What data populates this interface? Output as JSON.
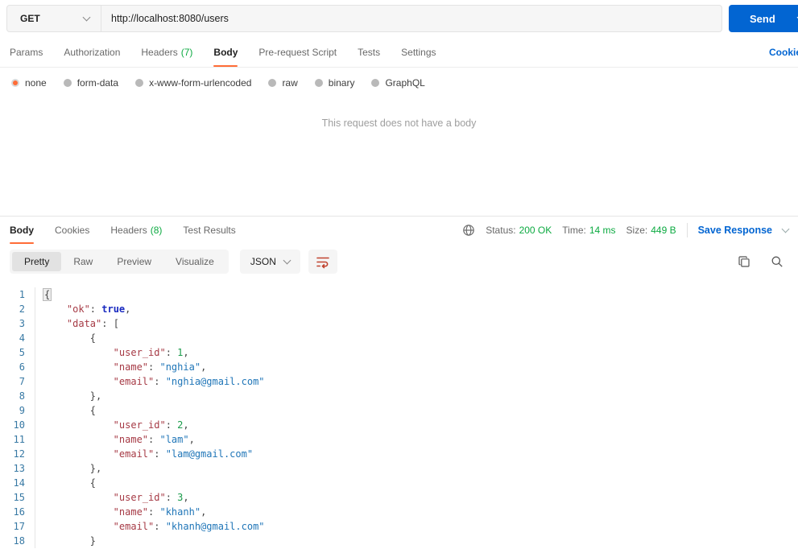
{
  "colors": {
    "accent": "#FF6C37",
    "blue": "#0265D2",
    "green": "#0CAA41"
  },
  "icons": [
    "chevron-down-icon",
    "globe-icon",
    "wrap-text-icon",
    "copy-icon",
    "search-icon"
  ],
  "request": {
    "method": "GET",
    "url": "http://localhost:8080/users",
    "send_label": "Send",
    "cookies_link": "Cookies",
    "tabs": [
      {
        "label": "Params"
      },
      {
        "label": "Authorization"
      },
      {
        "label": "Headers",
        "count": "(7)"
      },
      {
        "label": "Body",
        "active": true
      },
      {
        "label": "Pre-request Script"
      },
      {
        "label": "Tests"
      },
      {
        "label": "Settings"
      }
    ],
    "body_types": [
      "none",
      "form-data",
      "x-www-form-urlencoded",
      "raw",
      "binary",
      "GraphQL"
    ],
    "body_type_selected": "none",
    "empty_body_message": "This request does not have a body"
  },
  "response": {
    "tabs": [
      {
        "label": "Body",
        "active": true
      },
      {
        "label": "Cookies"
      },
      {
        "label": "Headers",
        "count": "(8)"
      },
      {
        "label": "Test Results"
      }
    ],
    "status_label": "Status:",
    "status_value": "200 OK",
    "time_label": "Time:",
    "time_value": "14 ms",
    "size_label": "Size:",
    "size_value": "449 B",
    "save_response_label": "Save Response",
    "view_modes": [
      "Pretty",
      "Raw",
      "Preview",
      "Visualize"
    ],
    "view_mode_active": "Pretty",
    "format": "JSON"
  },
  "code": {
    "lines": [
      {
        "n": 1,
        "indent": 0,
        "tokens": [
          [
            "brace",
            "{"
          ]
        ]
      },
      {
        "n": 2,
        "indent": 1,
        "tokens": [
          [
            "key",
            "\"ok\""
          ],
          [
            "punc",
            ": "
          ],
          [
            "bool",
            "true"
          ],
          [
            "punc",
            ","
          ]
        ]
      },
      {
        "n": 3,
        "indent": 1,
        "tokens": [
          [
            "key",
            "\"data\""
          ],
          [
            "punc",
            ": ["
          ]
        ]
      },
      {
        "n": 4,
        "indent": 2,
        "tokens": [
          [
            "punc",
            "{"
          ]
        ]
      },
      {
        "n": 5,
        "indent": 3,
        "tokens": [
          [
            "key",
            "\"user_id\""
          ],
          [
            "punc",
            ": "
          ],
          [
            "num",
            "1"
          ],
          [
            "punc",
            ","
          ]
        ]
      },
      {
        "n": 6,
        "indent": 3,
        "tokens": [
          [
            "key",
            "\"name\""
          ],
          [
            "punc",
            ": "
          ],
          [
            "str",
            "\"nghia\""
          ],
          [
            "punc",
            ","
          ]
        ]
      },
      {
        "n": 7,
        "indent": 3,
        "tokens": [
          [
            "key",
            "\"email\""
          ],
          [
            "punc",
            ": "
          ],
          [
            "str",
            "\"nghia@gmail.com\""
          ]
        ]
      },
      {
        "n": 8,
        "indent": 2,
        "tokens": [
          [
            "punc",
            "},"
          ]
        ]
      },
      {
        "n": 9,
        "indent": 2,
        "tokens": [
          [
            "punc",
            "{"
          ]
        ]
      },
      {
        "n": 10,
        "indent": 3,
        "tokens": [
          [
            "key",
            "\"user_id\""
          ],
          [
            "punc",
            ": "
          ],
          [
            "num",
            "2"
          ],
          [
            "punc",
            ","
          ]
        ]
      },
      {
        "n": 11,
        "indent": 3,
        "tokens": [
          [
            "key",
            "\"name\""
          ],
          [
            "punc",
            ": "
          ],
          [
            "str",
            "\"lam\""
          ],
          [
            "punc",
            ","
          ]
        ]
      },
      {
        "n": 12,
        "indent": 3,
        "tokens": [
          [
            "key",
            "\"email\""
          ],
          [
            "punc",
            ": "
          ],
          [
            "str",
            "\"lam@gmail.com\""
          ]
        ]
      },
      {
        "n": 13,
        "indent": 2,
        "tokens": [
          [
            "punc",
            "},"
          ]
        ]
      },
      {
        "n": 14,
        "indent": 2,
        "tokens": [
          [
            "punc",
            "{"
          ]
        ]
      },
      {
        "n": 15,
        "indent": 3,
        "tokens": [
          [
            "key",
            "\"user_id\""
          ],
          [
            "punc",
            ": "
          ],
          [
            "num",
            "3"
          ],
          [
            "punc",
            ","
          ]
        ]
      },
      {
        "n": 16,
        "indent": 3,
        "tokens": [
          [
            "key",
            "\"name\""
          ],
          [
            "punc",
            ": "
          ],
          [
            "str",
            "\"khanh\""
          ],
          [
            "punc",
            ","
          ]
        ]
      },
      {
        "n": 17,
        "indent": 3,
        "tokens": [
          [
            "key",
            "\"email\""
          ],
          [
            "punc",
            ": "
          ],
          [
            "str",
            "\"khanh@gmail.com\""
          ]
        ]
      },
      {
        "n": 18,
        "indent": 2,
        "tokens": [
          [
            "punc",
            "}"
          ]
        ]
      }
    ]
  }
}
